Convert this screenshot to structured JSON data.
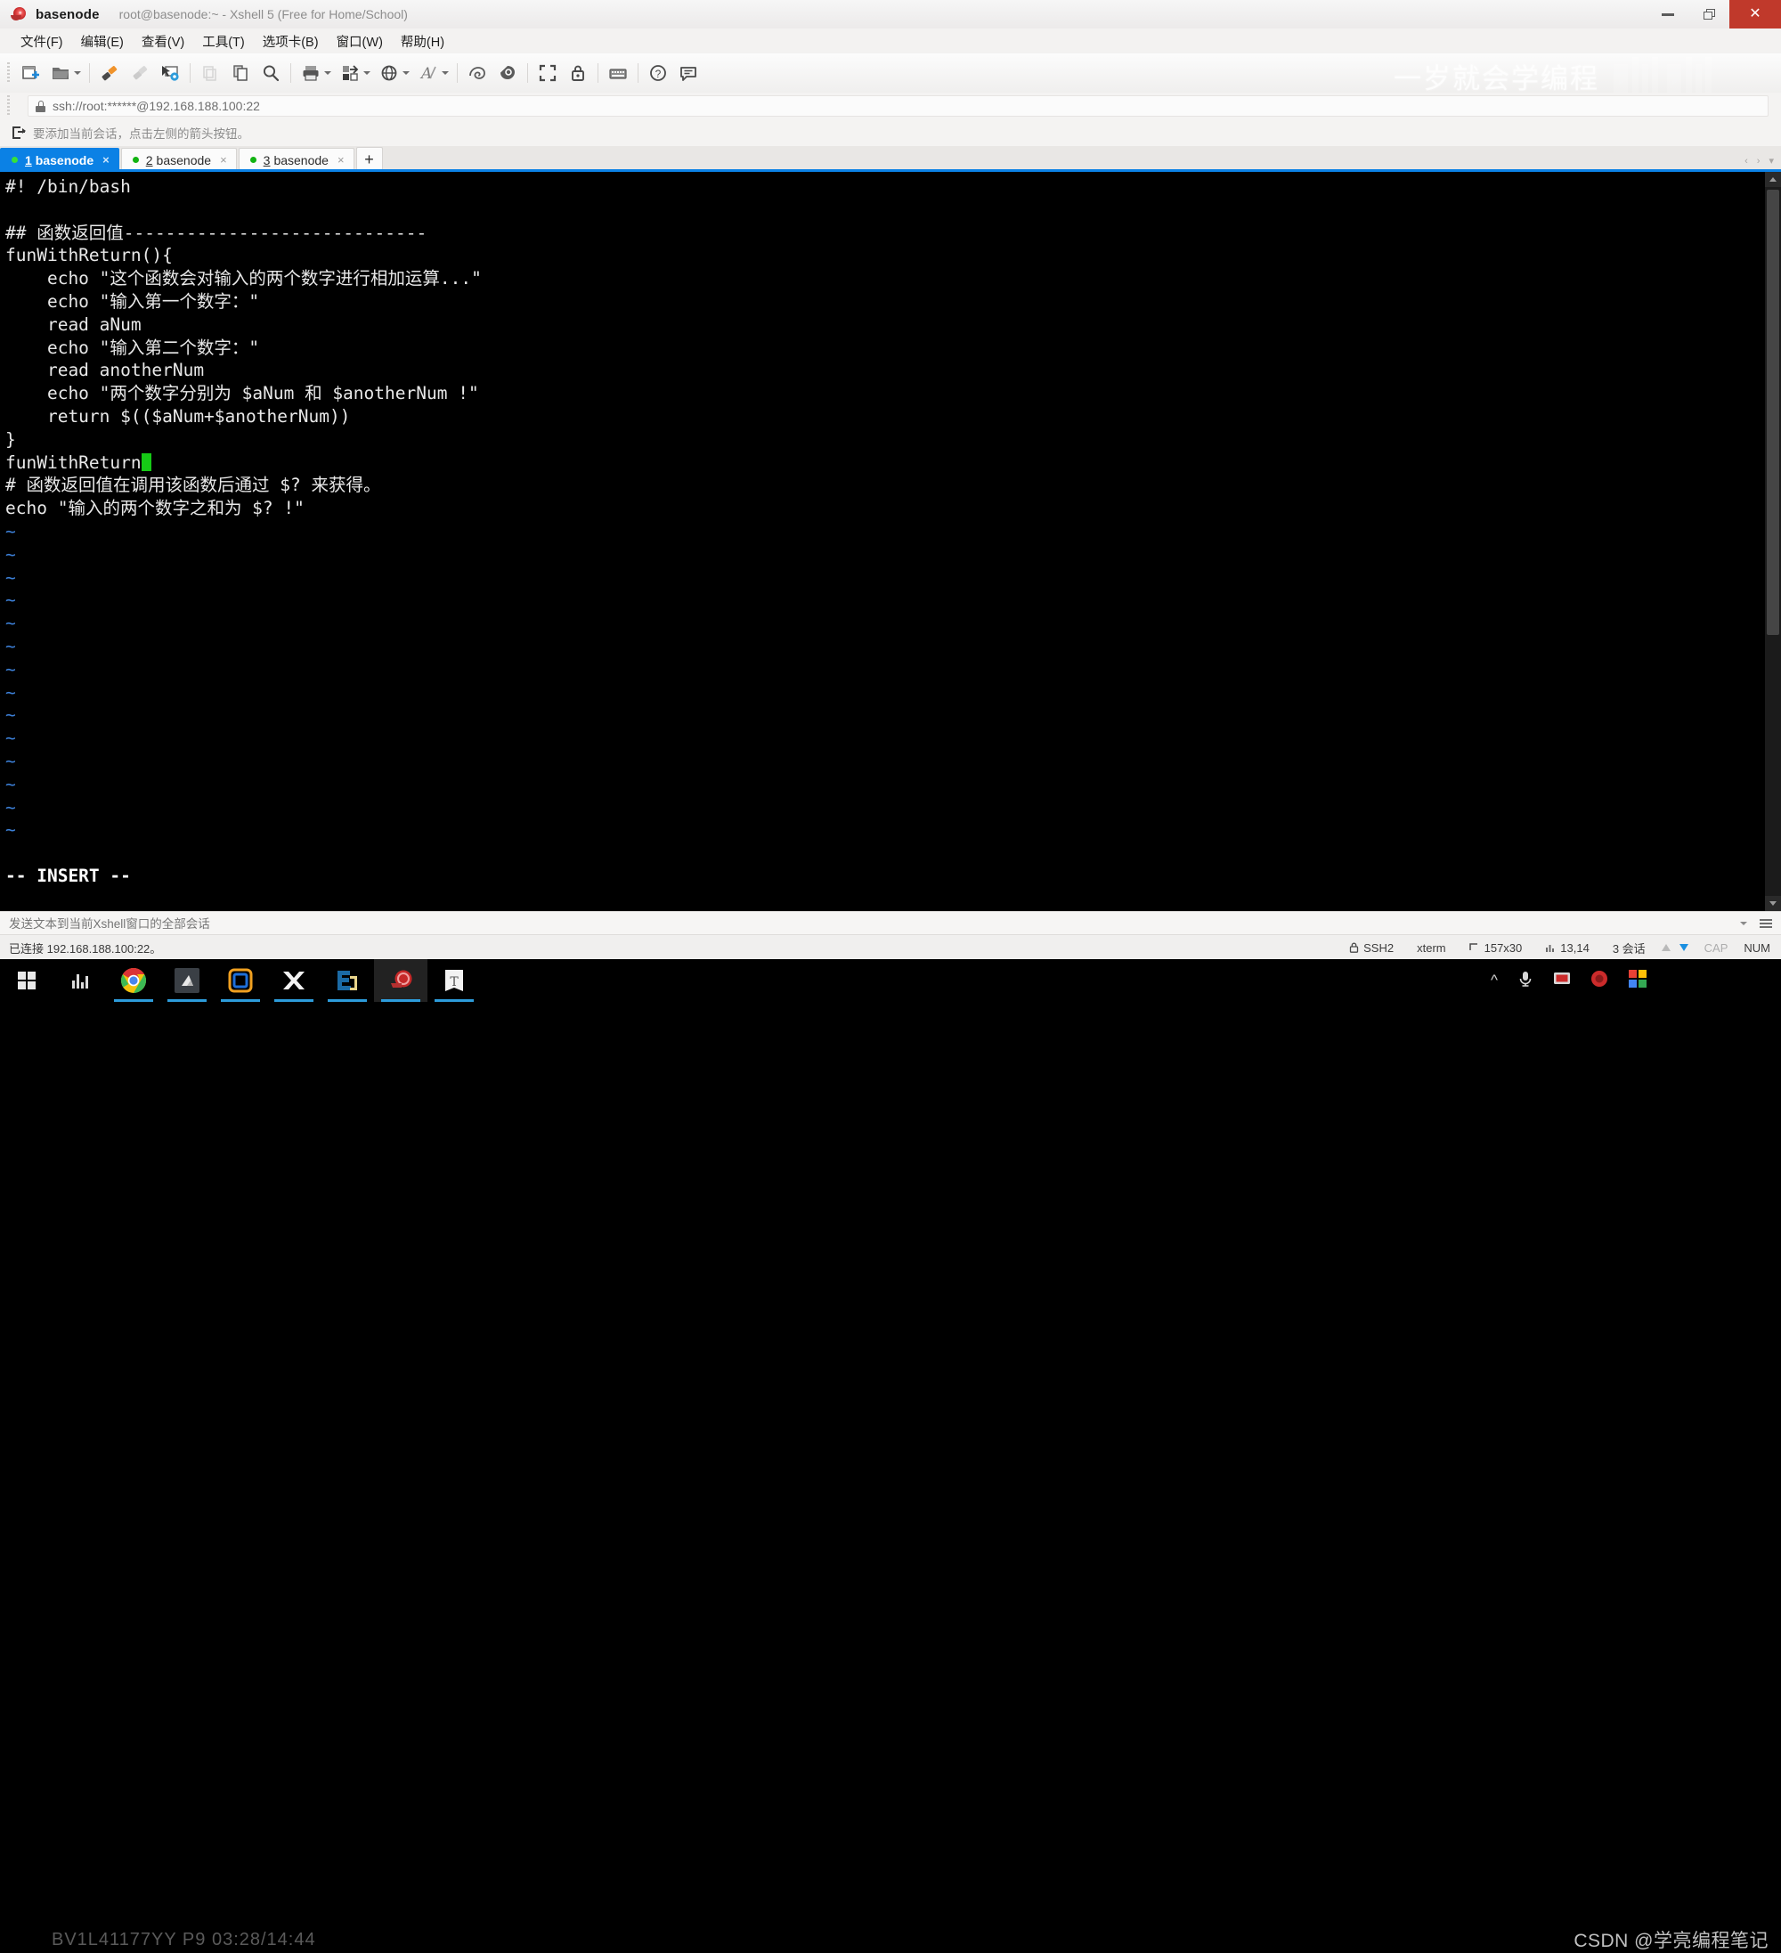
{
  "window": {
    "app_name": "basenode",
    "title": "root@basenode:~ - Xshell 5 (Free for Home/School)",
    "app_icon": "snail-icon",
    "minimize_label": "–",
    "maximize_label": "❐",
    "close_label": "✕"
  },
  "menubar": {
    "items": [
      {
        "label": "文件(F)",
        "name": "menu-file"
      },
      {
        "label": "编辑(E)",
        "name": "menu-edit"
      },
      {
        "label": "查看(V)",
        "name": "menu-view"
      },
      {
        "label": "工具(T)",
        "name": "menu-tools"
      },
      {
        "label": "选项卡(B)",
        "name": "menu-tabs"
      },
      {
        "label": "窗口(W)",
        "name": "menu-window"
      },
      {
        "label": "帮助(H)",
        "name": "menu-help"
      }
    ]
  },
  "toolbar": {
    "icons": [
      "new-session-icon",
      "open-folder-icon",
      "folder-dropdown-caret",
      "connect-icon",
      "disconnect-icon",
      "session-properties-icon",
      "copy-disabled-icon",
      "paste-icon",
      "find-icon",
      "print-icon",
      "print-dropdown-caret",
      "transfer-file-icon",
      "transfer-dropdown-caret",
      "globe-icon",
      "globe-dropdown-caret",
      "font-icon",
      "font-dropdown-caret",
      "xftp-icon",
      "xftp-alt-icon",
      "fullscreen-icon",
      "lock-icon",
      "keyboard-icon",
      "help-icon",
      "comment-icon"
    ]
  },
  "address_bar": {
    "lock_icon": "lock-icon",
    "value": "ssh://root:******@192.168.188.100:22"
  },
  "hint_bar": {
    "icon": "add-session-arrow-icon",
    "text": "要添加当前会话，点击左侧的箭头按钮。"
  },
  "watermark": {
    "text": "一岁就会学编程",
    "logo": "bilibili-logo"
  },
  "tabs": {
    "items": [
      {
        "num": "1",
        "label": "basenode",
        "active": true,
        "close": "×"
      },
      {
        "num": "2",
        "label": "basenode",
        "active": false,
        "close": "×"
      },
      {
        "num": "3",
        "label": "basenode",
        "active": false,
        "close": "×"
      }
    ],
    "new_tab_label": "+",
    "nav_left": "‹",
    "nav_right": "›",
    "nav_menu": "▾"
  },
  "terminal": {
    "lines": [
      {
        "text": "#! /bin/bash",
        "cls": "code"
      },
      {
        "text": "",
        "cls": "code"
      },
      {
        "text": "## 函数返回值-----------------------------",
        "cls": "code"
      },
      {
        "text": "funWithReturn(){",
        "cls": "code"
      },
      {
        "text": "    echo \"这个函数会对输入的两个数字进行相加运算...\"",
        "cls": "code"
      },
      {
        "text": "    echo \"输入第一个数字：\"",
        "cls": "code"
      },
      {
        "text": "    read aNum",
        "cls": "code"
      },
      {
        "text": "    echo \"输入第二个数字：\"",
        "cls": "code"
      },
      {
        "text": "    read anotherNum",
        "cls": "code"
      },
      {
        "text": "    echo \"两个数字分别为 $aNum 和 $anotherNum !\"",
        "cls": "code"
      },
      {
        "text": "    return $(($aNum+$anotherNum))",
        "cls": "code"
      },
      {
        "text": "}",
        "cls": "code"
      },
      {
        "text": "funWithReturn",
        "cls": "code",
        "cursor": true
      },
      {
        "text": "# 函数返回值在调用该函数后通过 $? 来获得。",
        "cls": "code"
      },
      {
        "text": "echo \"输入的两个数字之和为 $? !\"",
        "cls": "code"
      },
      {
        "text": "~",
        "cls": "tilde"
      },
      {
        "text": "~",
        "cls": "tilde"
      },
      {
        "text": "~",
        "cls": "tilde"
      },
      {
        "text": "~",
        "cls": "tilde"
      },
      {
        "text": "~",
        "cls": "tilde"
      },
      {
        "text": "~",
        "cls": "tilde"
      },
      {
        "text": "~",
        "cls": "tilde"
      },
      {
        "text": "~",
        "cls": "tilde"
      },
      {
        "text": "~",
        "cls": "tilde"
      },
      {
        "text": "~",
        "cls": "tilde"
      },
      {
        "text": "~",
        "cls": "tilde"
      },
      {
        "text": "~",
        "cls": "tilde"
      },
      {
        "text": "~",
        "cls": "tilde"
      },
      {
        "text": "~",
        "cls": "tilde"
      },
      {
        "text": "",
        "cls": "code"
      },
      {
        "text": "-- INSERT --",
        "cls": "insert"
      }
    ],
    "cursor_color": "#16c916",
    "tilde_color": "#3c7fd6",
    "bg_color": "#000000",
    "fg_color": "#e8e8e8"
  },
  "send_bar": {
    "placeholder": "发送文本到当前Xshell窗口的全部会话",
    "value": ""
  },
  "status_bar": {
    "connection": "已连接 192.168.188.100:22。",
    "protocol": "SSH2",
    "terminal_type": "xterm",
    "size": "157x30",
    "cursor_pos": "13,14",
    "sessions": "3 会话",
    "cap": "CAP",
    "num": "NUM",
    "lock_icon": "lock-icon",
    "size_icon": "window-size-icon",
    "pos_icon": "cursor-pos-icon",
    "up_arrow": "upload-arrow-icon",
    "down_arrow": "download-arrow-icon"
  },
  "taskbar": {
    "items": [
      {
        "name": "start-button",
        "icon": "windows-logo-icon"
      },
      {
        "name": "taskbar-bilibili",
        "icon": "bilibili-icon"
      },
      {
        "name": "taskbar-chrome",
        "icon": "chrome-icon"
      },
      {
        "name": "taskbar-video",
        "icon": "video-icon"
      },
      {
        "name": "taskbar-app-blue",
        "icon": "blue-square-icon"
      },
      {
        "name": "taskbar-xmind",
        "icon": "xmind-icon"
      },
      {
        "name": "taskbar-editplus",
        "icon": "editplus-icon"
      },
      {
        "name": "taskbar-xshell",
        "icon": "snail-icon"
      },
      {
        "name": "taskbar-typora",
        "icon": "typora-icon"
      }
    ],
    "ghost_text": "BV1L41177YY P9 03:28/14:44",
    "tray": [
      {
        "name": "tray-expand",
        "icon": "chevron-up-icon"
      },
      {
        "name": "tray-microphone",
        "icon": "microphone-icon"
      },
      {
        "name": "tray-screen",
        "icon": "screen-icon"
      },
      {
        "name": "tray-record",
        "icon": "record-icon"
      },
      {
        "name": "tray-csdn",
        "icon": "csdn-icon"
      }
    ],
    "csdn_text": "CSDN @学亮编程笔记"
  }
}
